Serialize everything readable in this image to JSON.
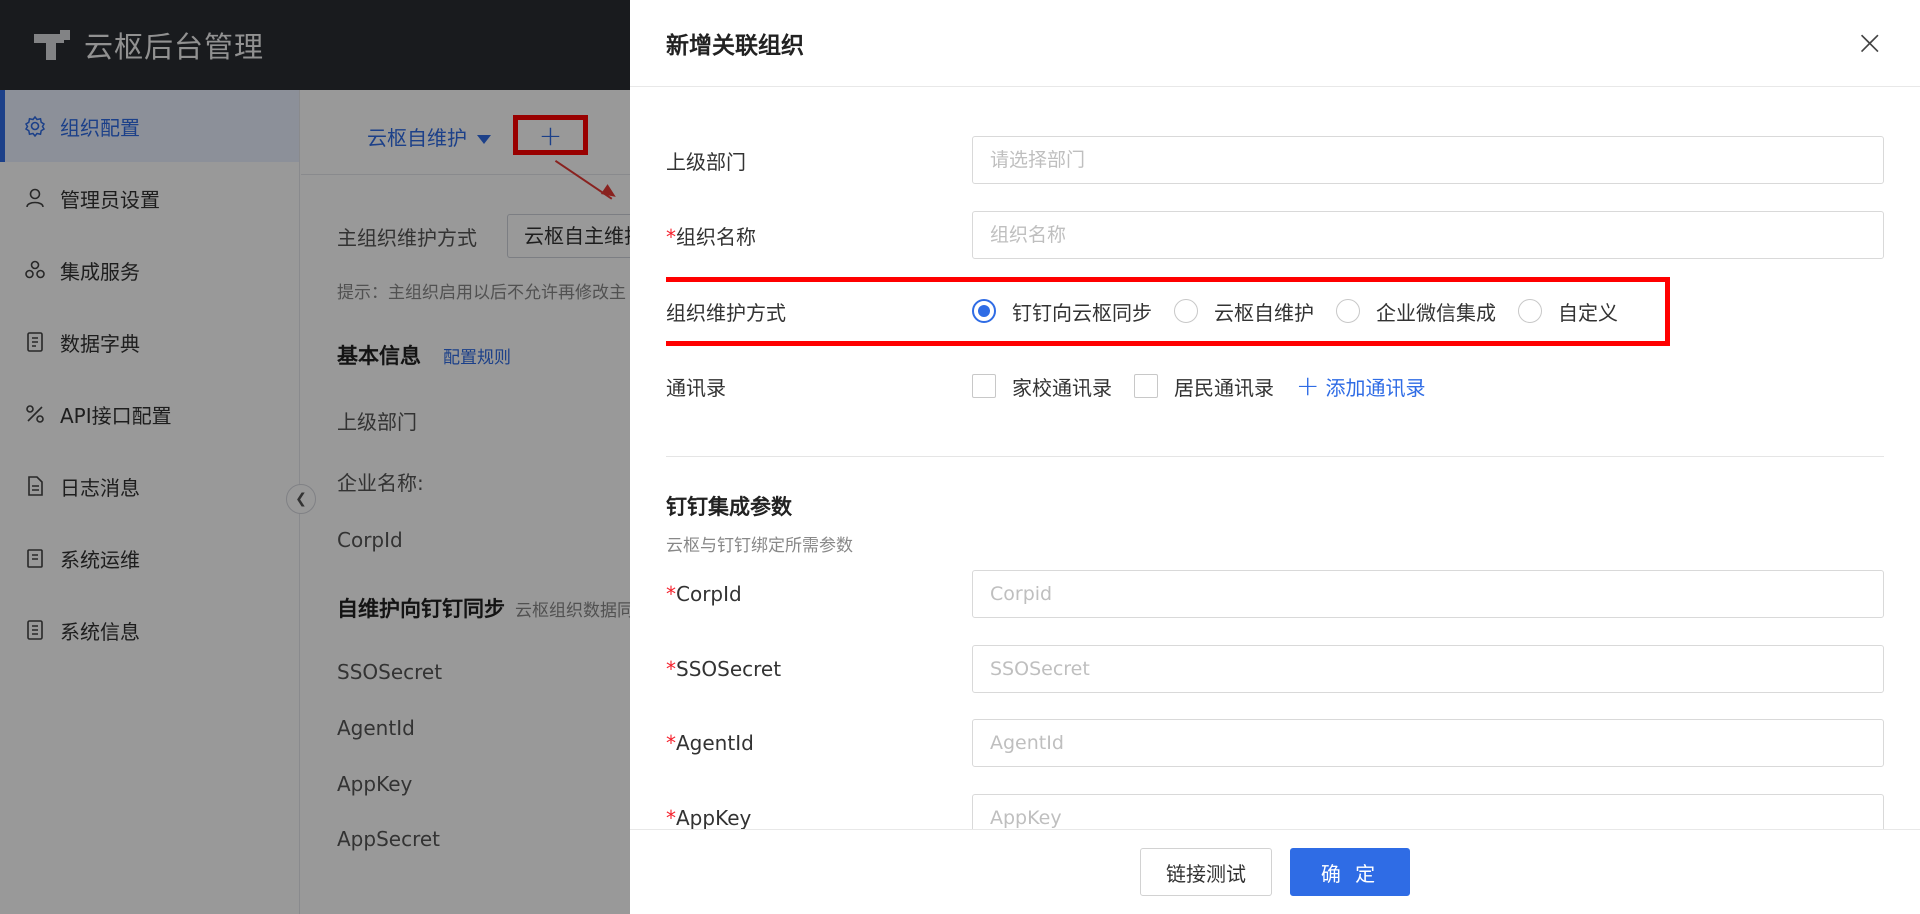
{
  "app": {
    "title": "云枢后台管理"
  },
  "sidebar": {
    "items": [
      {
        "label": "组织配置",
        "icon": "gear-icon",
        "active": true
      },
      {
        "label": "管理员设置",
        "icon": "user-icon"
      },
      {
        "label": "集成服务",
        "icon": "cloud-icon"
      },
      {
        "label": "数据字典",
        "icon": "book-icon"
      },
      {
        "label": "API接口配置",
        "icon": "api-icon"
      },
      {
        "label": "日志消息",
        "icon": "file-icon"
      },
      {
        "label": "系统运维",
        "icon": "clipboard-icon"
      },
      {
        "label": "系统信息",
        "icon": "info-doc-icon"
      }
    ]
  },
  "background": {
    "tab_label": "云枢自维护",
    "plus_label": "+",
    "main_mode_label": "主组织维护方式",
    "main_mode_value": "云枢自主维护",
    "hint": "提示：主组织启用以后不允许再修改主",
    "basic_info_title": "基本信息",
    "config_rule_link": "配置规则",
    "fields": [
      "上级部门",
      "企业名称:",
      "CorpId"
    ],
    "sync_title": "自维护向钉钉同步",
    "sync_sub": "云枢组织数据同",
    "sync_fields": [
      "SSOSecret",
      "AgentId",
      "AppKey",
      "AppSecret"
    ]
  },
  "drawer": {
    "title": "新增关联组织",
    "close": "×",
    "form": {
      "parent_dept": {
        "label": "上级部门",
        "placeholder": "请选择部门"
      },
      "org_name": {
        "label": "组织名称",
        "placeholder": "组织名称"
      },
      "maintain_mode": {
        "label": "组织维护方式",
        "options": [
          "钉钉向云枢同步",
          "云枢自维护",
          "企业微信集成",
          "自定义"
        ],
        "selected": "钉钉向云枢同步"
      },
      "contacts": {
        "label": "通讯录",
        "options": [
          "家校通讯录",
          "居民通讯录"
        ],
        "add_label": "添加通讯录"
      },
      "section_title": "钉钉集成参数",
      "section_sub": "云枢与钉钉绑定所需参数",
      "corpid": {
        "label": "CorpId",
        "placeholder": "Corpid"
      },
      "ssosecret": {
        "label": "SSOSecret",
        "placeholder": "SSOSecret"
      },
      "agentid": {
        "label": "AgentId",
        "placeholder": "AgentId"
      },
      "appkey": {
        "label": "AppKey",
        "placeholder": "AppKey"
      }
    },
    "footer": {
      "test_label": "链接测试",
      "confirm_label": "确 定"
    }
  },
  "colors": {
    "accent": "#2f6ce5",
    "highlight": "#ff0000",
    "header_bg": "#2a2d33"
  }
}
